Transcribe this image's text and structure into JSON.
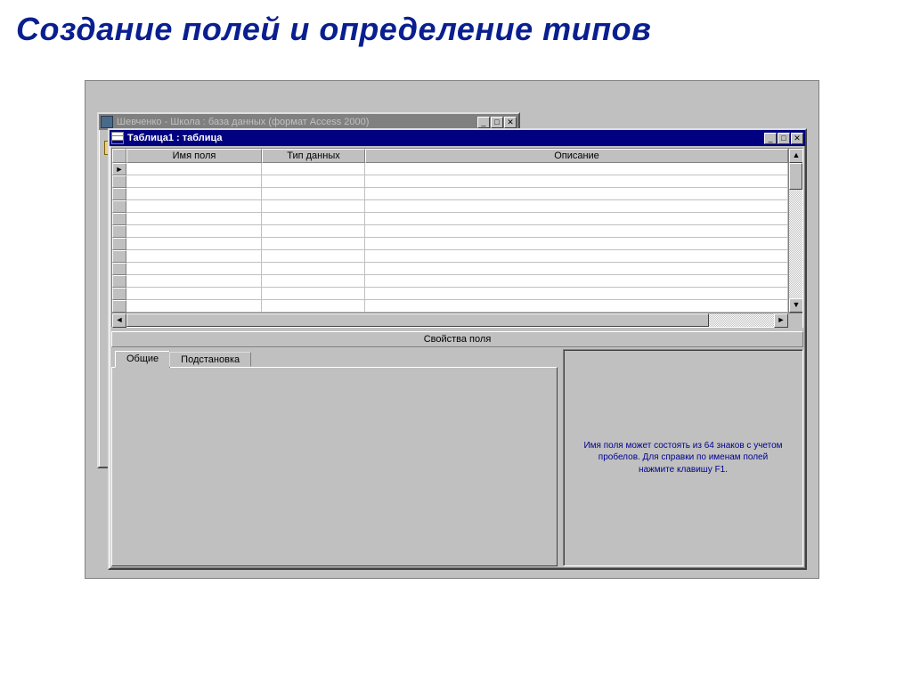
{
  "page_title": "Создание полей и определение типов",
  "db_window": {
    "title": "Шевченко - Школа : база данных (формат Access 2000)"
  },
  "table_window": {
    "title": "Таблица1 : таблица",
    "columns": {
      "field_name": "Имя поля",
      "data_type": "Тип данных",
      "description": "Описание"
    },
    "rows": [
      {
        "name": "",
        "type": "",
        "desc": ""
      },
      {
        "name": "",
        "type": "",
        "desc": ""
      },
      {
        "name": "",
        "type": "",
        "desc": ""
      },
      {
        "name": "",
        "type": "",
        "desc": ""
      },
      {
        "name": "",
        "type": "",
        "desc": ""
      },
      {
        "name": "",
        "type": "",
        "desc": ""
      },
      {
        "name": "",
        "type": "",
        "desc": ""
      },
      {
        "name": "",
        "type": "",
        "desc": ""
      },
      {
        "name": "",
        "type": "",
        "desc": ""
      },
      {
        "name": "",
        "type": "",
        "desc": ""
      },
      {
        "name": "",
        "type": "",
        "desc": ""
      },
      {
        "name": "",
        "type": "",
        "desc": ""
      }
    ],
    "properties_caption": "Свойства поля",
    "tabs": {
      "general": "Общие",
      "lookup": "Подстановка"
    },
    "help_text": "Имя поля может состоять из 64 знаков с учетом пробелов.  Для справки по именам полей нажмите клавишу F1."
  },
  "glyphs": {
    "min": "_",
    "max": "□",
    "close": "✕",
    "up": "▲",
    "down": "▼",
    "left": "◄",
    "right": "►",
    "current": "►"
  }
}
